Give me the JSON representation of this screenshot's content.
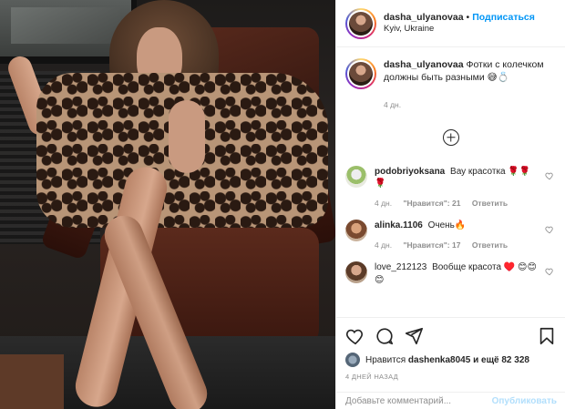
{
  "post": {
    "author": "dasha_ulyanovaa",
    "separator": "•",
    "follow_label": "Подписаться",
    "location": "Kyiv, Ukraine",
    "caption_text": "Фотки с колечком должны быть разными 😅💍",
    "caption_time": "4 дн.",
    "load_more_icon": "plus-circle-icon"
  },
  "comments": [
    {
      "user": "podobriyoksana",
      "text": "Вау красотка 🌹🌹🌹",
      "time": "4 дн.",
      "likes": "\"Нравится\": 21",
      "reply": "Ответить"
    },
    {
      "user": "alinka.1106",
      "text": "Очень🔥",
      "time": "4 дн.",
      "likes": "\"Нравится\": 17",
      "reply": "Ответить"
    },
    {
      "user": "love_212123",
      "text": "Вообще красота ♥️ 😊😊😊",
      "time": "",
      "likes": "",
      "reply": ""
    }
  ],
  "actions": {
    "like_icon": "heart-icon",
    "comment_icon": "comment-icon",
    "share_icon": "share-icon",
    "save_icon": "bookmark-icon"
  },
  "likes": {
    "prefix": "Нравится",
    "user": "dashenka8045",
    "suffix": "и ещё 82 328"
  },
  "time_ago": "4 ДНЕЙ НАЗАД",
  "add_comment": {
    "placeholder": "Добавьте комментарий...",
    "publish_label": "Опубликовать"
  },
  "colors": {
    "link_blue": "#0095f6",
    "publish_disabled": "#b2dffc",
    "muted_text": "#8e8e8e"
  }
}
